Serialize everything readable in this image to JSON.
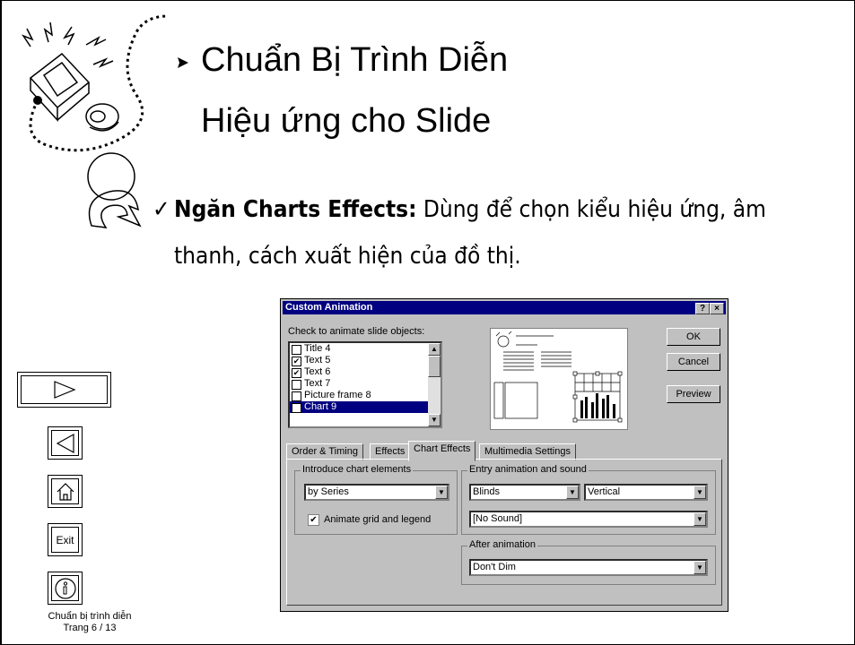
{
  "slide": {
    "title_line1": "Chuẩn Bị Trình Diễn",
    "title_line2": "Hiệu ứng cho Slide",
    "bullet_bold": "Ngăn Charts Effects:",
    "bullet_text": " Dùng để chọn kiểu hiệu ứng, âm thanh, cách xuất hiện của đồ thị."
  },
  "nav": {
    "exit_label": "Exit",
    "footer_line1": "Chuẩn bị trình diễn",
    "footer_line2": "Trang 6 / 13"
  },
  "dialog": {
    "title": "Custom Animation",
    "help_btn": "?",
    "close_btn": "×",
    "check_label": "Check to animate slide objects:",
    "objects": [
      {
        "label": "Title 4",
        "checked": false
      },
      {
        "label": "Text 5",
        "checked": true
      },
      {
        "label": "Text 6",
        "checked": true
      },
      {
        "label": "Text 7",
        "checked": false
      },
      {
        "label": "Picture frame 8",
        "checked": false
      },
      {
        "label": "Chart 9",
        "checked": true,
        "selected": true
      }
    ],
    "ok": "OK",
    "cancel": "Cancel",
    "preview": "Preview",
    "tabs": [
      "Order & Timing",
      "Effects",
      "Chart Effects",
      "Multimedia Settings"
    ],
    "active_tab": "Chart Effects",
    "introduce_label": "Introduce chart elements",
    "introduce_value": "by Series",
    "animate_grid_label": "Animate grid and legend",
    "animate_grid_checked": true,
    "entry_label": "Entry animation and sound",
    "entry_effect": "Blinds",
    "entry_direction": "Vertical",
    "sound_value": "[No Sound]",
    "after_label": "After animation",
    "after_value": "Don't Dim"
  }
}
